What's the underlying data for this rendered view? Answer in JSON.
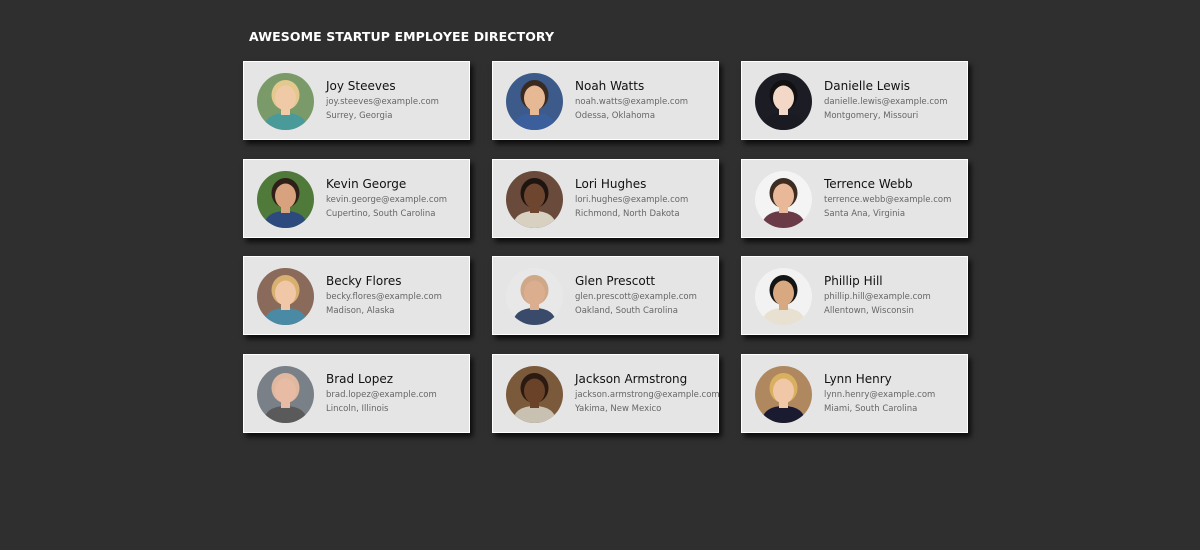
{
  "page": {
    "title": "AWESOME STARTUP EMPLOYEE DIRECTORY",
    "background_color": "#2f2f2f",
    "card_color": "#e5e5e5"
  },
  "employees": [
    {
      "name": "Joy Steeves",
      "email": "joy.steeves@example.com",
      "location": "Surrey, Georgia",
      "bg": "#7a9a6a",
      "hair": "#e4c98f",
      "skin": "#f0c9a6",
      "shirt": "#4a9a9a"
    },
    {
      "name": "Noah Watts",
      "email": "noah.watts@example.com",
      "location": "Odessa, Oklahoma",
      "bg": "#3c5a8a",
      "hair": "#3a2a20",
      "skin": "#e6b894",
      "shirt": "#3b5f9c"
    },
    {
      "name": "Danielle Lewis",
      "email": "danielle.lewis@example.com",
      "location": "Montgomery, Missouri",
      "bg": "#1c1c24",
      "hair": "#111111",
      "skin": "#f3d8c7",
      "shirt": "#1a1a22"
    },
    {
      "name": "Kevin George",
      "email": "kevin.george@example.com",
      "location": "Cupertino, South Carolina",
      "bg": "#4f7a3a",
      "hair": "#2e2018",
      "skin": "#d8a27e",
      "shirt": "#2c4a7e"
    },
    {
      "name": "Lori Hughes",
      "email": "lori.hughes@example.com",
      "location": "Richmond, North Dakota",
      "bg": "#6a4a3a",
      "hair": "#1e1410",
      "skin": "#6e4630",
      "shirt": "#d8d0c0"
    },
    {
      "name": "Terrence Webb",
      "email": "terrence.webb@example.com",
      "location": "Santa Ana, Virginia",
      "bg": "#f4f4f4",
      "hair": "#3c2c22",
      "skin": "#e8b898",
      "shirt": "#6a3a46"
    },
    {
      "name": "Becky Flores",
      "email": "becky.flores@example.com",
      "location": "Madison, Alaska",
      "bg": "#8a6a5a",
      "hair": "#d8b070",
      "skin": "#f0c8a8",
      "shirt": "#4a8aa4"
    },
    {
      "name": "Glen Prescott",
      "email": "glen.prescott@example.com",
      "location": "Oakland, South Carolina",
      "bg": "#e8e8e8",
      "hair": "#cfa888",
      "skin": "#dcae90",
      "shirt": "#3a4a6a"
    },
    {
      "name": "Phillip Hill",
      "email": "phillip.hill@example.com",
      "location": "Allentown, Wisconsin",
      "bg": "#f2f2f2",
      "hair": "#141414",
      "skin": "#d8a880",
      "shirt": "#e8e0d0"
    },
    {
      "name": "Brad Lopez",
      "email": "brad.lopez@example.com",
      "location": "Lincoln, Illinois",
      "bg": "#7a8088",
      "hair": "#e0b8a0",
      "skin": "#e8bca4",
      "shirt": "#5a5a5a"
    },
    {
      "name": "Jackson Armstrong",
      "email": "jackson.armstrong@example.com",
      "location": "Yakima, New Mexico",
      "bg": "#7a5a3a",
      "hair": "#2a1a12",
      "skin": "#6a4228",
      "shirt": "#c8c0b0"
    },
    {
      "name": "Lynn Henry",
      "email": "lynn.henry@example.com",
      "location": "Miami, South Carolina",
      "bg": "#b08860",
      "hair": "#d8b060",
      "skin": "#f0c8a8",
      "shirt": "#1a1a30"
    }
  ]
}
